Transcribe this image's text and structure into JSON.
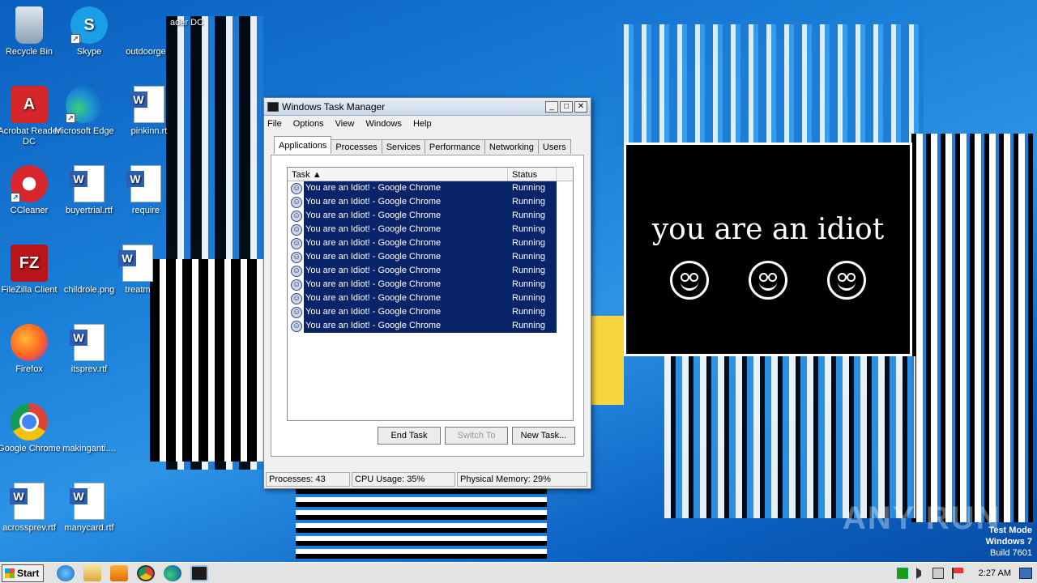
{
  "desktop": {
    "icons": [
      {
        "label": "Recycle Bin",
        "icon": "recycle-bin-icon"
      },
      {
        "label": "Skype",
        "icon": "skype-icon"
      },
      {
        "label": "outdoorge",
        "icon": "blank-file-icon"
      },
      {
        "label": "Acrobat Reader DC",
        "icon": "acrobat-icon"
      },
      {
        "label": "Microsoft Edge",
        "icon": "edge-icon"
      },
      {
        "label": "pinkinn.rt",
        "icon": "word-doc-icon"
      },
      {
        "label": "CCleaner",
        "icon": "ccleaner-icon"
      },
      {
        "label": "buyertrial.rtf",
        "icon": "word-doc-icon"
      },
      {
        "label": "require",
        "icon": "word-doc-icon"
      },
      {
        "label": "FileZilla Client",
        "icon": "filezilla-icon"
      },
      {
        "label": "childrole.png",
        "icon": "blank-file-icon"
      },
      {
        "label": "treatm",
        "icon": "word-doc-icon"
      },
      {
        "label": "Firefox",
        "icon": "firefox-icon"
      },
      {
        "label": "itsprev.rtf",
        "icon": "word-doc-icon"
      },
      {
        "label": "Google Chrome",
        "icon": "chrome-icon"
      },
      {
        "label": "makinganti....",
        "icon": "blank-file-icon"
      },
      {
        "label": "acrossprev.rtf",
        "icon": "word-doc-icon"
      },
      {
        "label": "manycard.rtf",
        "icon": "word-doc-icon"
      }
    ],
    "partial_label": "ader DC"
  },
  "task_manager": {
    "title": "Windows Task Manager",
    "menu": [
      "File",
      "Options",
      "View",
      "Windows",
      "Help"
    ],
    "tabs": [
      "Applications",
      "Processes",
      "Services",
      "Performance",
      "Networking",
      "Users"
    ],
    "active_tab": "Applications",
    "columns": {
      "task": "Task",
      "status": "Status"
    },
    "rows": [
      {
        "task": "You are an Idiot! - Google Chrome",
        "status": "Running"
      },
      {
        "task": "You are an Idiot! - Google Chrome",
        "status": "Running"
      },
      {
        "task": "You are an Idiot! - Google Chrome",
        "status": "Running"
      },
      {
        "task": "You are an Idiot! - Google Chrome",
        "status": "Running"
      },
      {
        "task": "You are an Idiot! - Google Chrome",
        "status": "Running"
      },
      {
        "task": "You are an Idiot! - Google Chrome",
        "status": "Running"
      },
      {
        "task": "You are an Idiot! - Google Chrome",
        "status": "Running"
      },
      {
        "task": "You are an Idiot! - Google Chrome",
        "status": "Running"
      },
      {
        "task": "You are an Idiot! - Google Chrome",
        "status": "Running"
      },
      {
        "task": "You are an Idiot! - Google Chrome",
        "status": "Running"
      },
      {
        "task": "You are an Idiot! - Google Chrome",
        "status": "Running"
      }
    ],
    "buttons": {
      "end_task": "End Task",
      "switch_to": "Switch To",
      "new_task": "New Task..."
    },
    "status_bar": {
      "processes": "Processes: 43",
      "cpu": "CPU Usage: 35%",
      "memory": "Physical Memory: 29%"
    }
  },
  "idiot_window": {
    "message": "you are an idiot"
  },
  "watermark": {
    "test_mode": "Test Mode",
    "os": "Windows 7",
    "build": "Build 7601",
    "brand": "ANY RUN"
  },
  "taskbar": {
    "start_label": "Start",
    "clock": "2:27 AM"
  },
  "colors": {
    "selection": "#0a246a",
    "desktop": "#1a7fd8"
  }
}
